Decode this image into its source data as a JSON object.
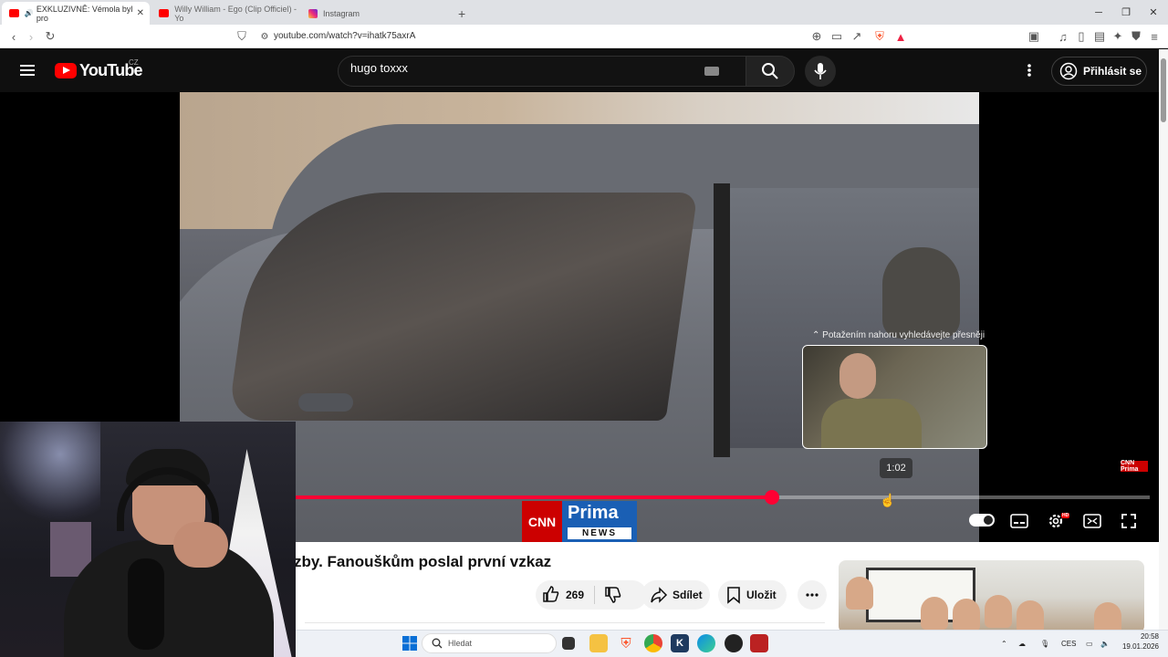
{
  "browser": {
    "tabs": [
      {
        "label": "EXKLUZIVNĚ: Vémola byl pro",
        "active": true,
        "favicon": "youtube-icon",
        "color": "#ff0000"
      },
      {
        "label": "Willy William - Ego (Clip Officiel) - Yo",
        "active": false,
        "favicon": "youtube-icon",
        "color": "#ff0000"
      },
      {
        "label": "Instagram",
        "active": false,
        "favicon": "instagram-icon",
        "color": "#d6249f"
      }
    ],
    "new_tab_label": "+",
    "url": "youtube.com/watch?v=ihatk75axrA"
  },
  "youtube": {
    "logo_text": "YouTube",
    "country_code": "CZ",
    "search_value": "hugo toxxx",
    "signin_label": "Přihlásit se",
    "accent_color": "#ff0000"
  },
  "player": {
    "hint_text": "⌃ Potažením nahoru vyhledávejte přesněji",
    "preview_time": "1:02",
    "progress_fraction": 0.558,
    "progress_color": "#ff0033",
    "brand_left": "CNN",
    "brand_right_top": "Prima",
    "brand_right_bottom": "NEWS",
    "watermark": "CNN Prima",
    "hd_badge": "HD"
  },
  "video_info": {
    "title": "zby. Fanouškům poslal první vzkaz",
    "like_count": "269",
    "share_label": "Sdílet",
    "save_label": "Uložit"
  },
  "taskbar": {
    "search_placeholder": "Hledat",
    "language": "CES",
    "time": "20:58",
    "date": "19.01.2026"
  }
}
